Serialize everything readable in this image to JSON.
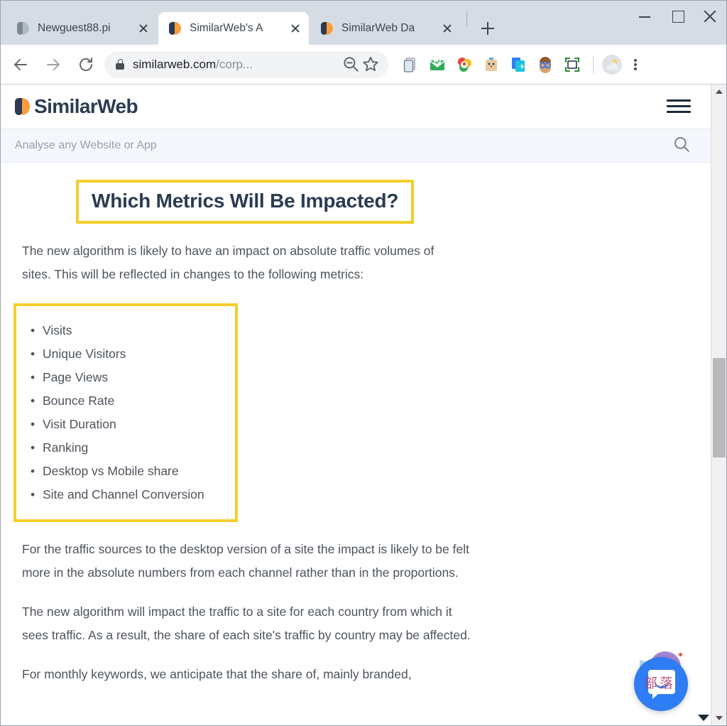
{
  "browser": {
    "tabs": [
      {
        "title": "Newguest88.pi",
        "favicon": "similarweb-favicon-grey",
        "active": false
      },
      {
        "title": "SimilarWeb's A",
        "favicon": "similarweb-favicon",
        "active": true
      },
      {
        "title": "SimilarWeb Da",
        "favicon": "similarweb-favicon",
        "active": false
      }
    ],
    "new_tab_label": "+",
    "window_controls": {
      "minimize": "–",
      "maximize": "□",
      "close": "✕"
    },
    "toolbar": {
      "back_label": "Back",
      "forward_label": "Forward",
      "reload_label": "Reload",
      "url_domain": "similarweb.com",
      "url_path": "/corp...",
      "zoom_out_label": "Zoom out",
      "bookmark_label": "Bookmark this page",
      "extensions": [
        {
          "name": "clipboard-pages-icon",
          "glyph": "🗒"
        },
        {
          "name": "mail-check-icon",
          "glyph": "✉"
        },
        {
          "name": "google-colored-icon",
          "glyph": "🌈"
        },
        {
          "name": "robot-box-icon",
          "glyph": "📦"
        },
        {
          "name": "page-share-icon",
          "glyph": "🗘"
        },
        {
          "name": "glasses-face-icon",
          "glyph": "🤓"
        },
        {
          "name": "capture-frame-icon",
          "glyph": "⬜"
        }
      ],
      "profile_label": "Profile",
      "menu_label": "Customise and control"
    }
  },
  "site": {
    "logo_text": "SimilarWeb",
    "menu_label": "Menu",
    "search": {
      "placeholder": "Analyse any Website or App",
      "icon_label": "Search"
    }
  },
  "article": {
    "heading": "Which Metrics Will Be Impacted?",
    "intro_paragraph": "The new algorithm is likely to have an impact on absolute traffic volumes of sites. This will be reflected in changes to the following metrics:",
    "metrics": [
      "Visits",
      "Unique Visitors",
      "Page Views",
      "Bounce Rate",
      "Visit Duration",
      "Ranking",
      "Desktop vs Mobile share",
      "Site and Channel Conversion"
    ],
    "paragraph_2": "For the traffic sources to the desktop version of a site the impact is likely to be felt more in the absolute numbers from each channel rather than in the proportions.",
    "paragraph_3": "The new algorithm will impact the traffic to a site for each country from which it sees traffic. As a result, the share of each site's traffic by country may be affected.",
    "paragraph_4": "For monthly keywords, we anticipate that the share of, mainly branded,"
  },
  "chat": {
    "label": "Open chat",
    "watermark_text": "部落"
  },
  "colors": {
    "highlight_yellow": "#f5ce2a",
    "brand_navy": "#2b3b52",
    "brand_orange": "#f89d3c",
    "body_text": "#4d535c",
    "chat_blue": "#2f7df4",
    "tabstrip_bg": "#d6dce4"
  }
}
